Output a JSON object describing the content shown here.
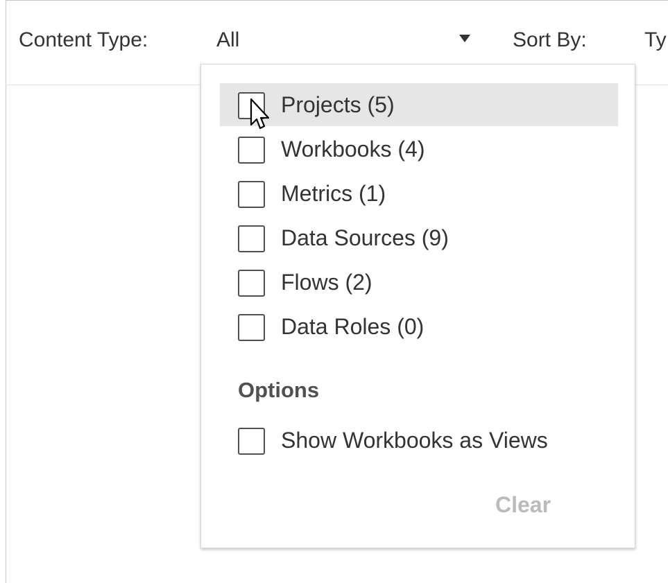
{
  "toolbar": {
    "content_type_label": "Content Type:",
    "content_type_value": "All",
    "sort_by_label": "Sort By:",
    "sort_by_value": "Ty"
  },
  "dropdown": {
    "options": [
      {
        "label": "Projects (5)",
        "checked": false,
        "hovered": true
      },
      {
        "label": "Workbooks (4)",
        "checked": false
      },
      {
        "label": "Metrics (1)",
        "checked": false
      },
      {
        "label": "Data Sources (9)",
        "checked": false
      },
      {
        "label": "Flows (2)",
        "checked": false
      },
      {
        "label": "Data Roles (0)",
        "checked": false
      }
    ],
    "options_title": "Options",
    "extra_options": [
      {
        "label": "Show Workbooks as Views",
        "checked": false
      }
    ],
    "clear_label": "Clear"
  },
  "colors": {
    "text": "#333333",
    "hover_row": "#e6e6e6",
    "checkbox_border": "#505050",
    "disabled_text": "#bbbbbb"
  },
  "icons": {
    "dropdown_arrow": "triangle-down-icon",
    "cursor": "mouse-pointer-icon"
  }
}
